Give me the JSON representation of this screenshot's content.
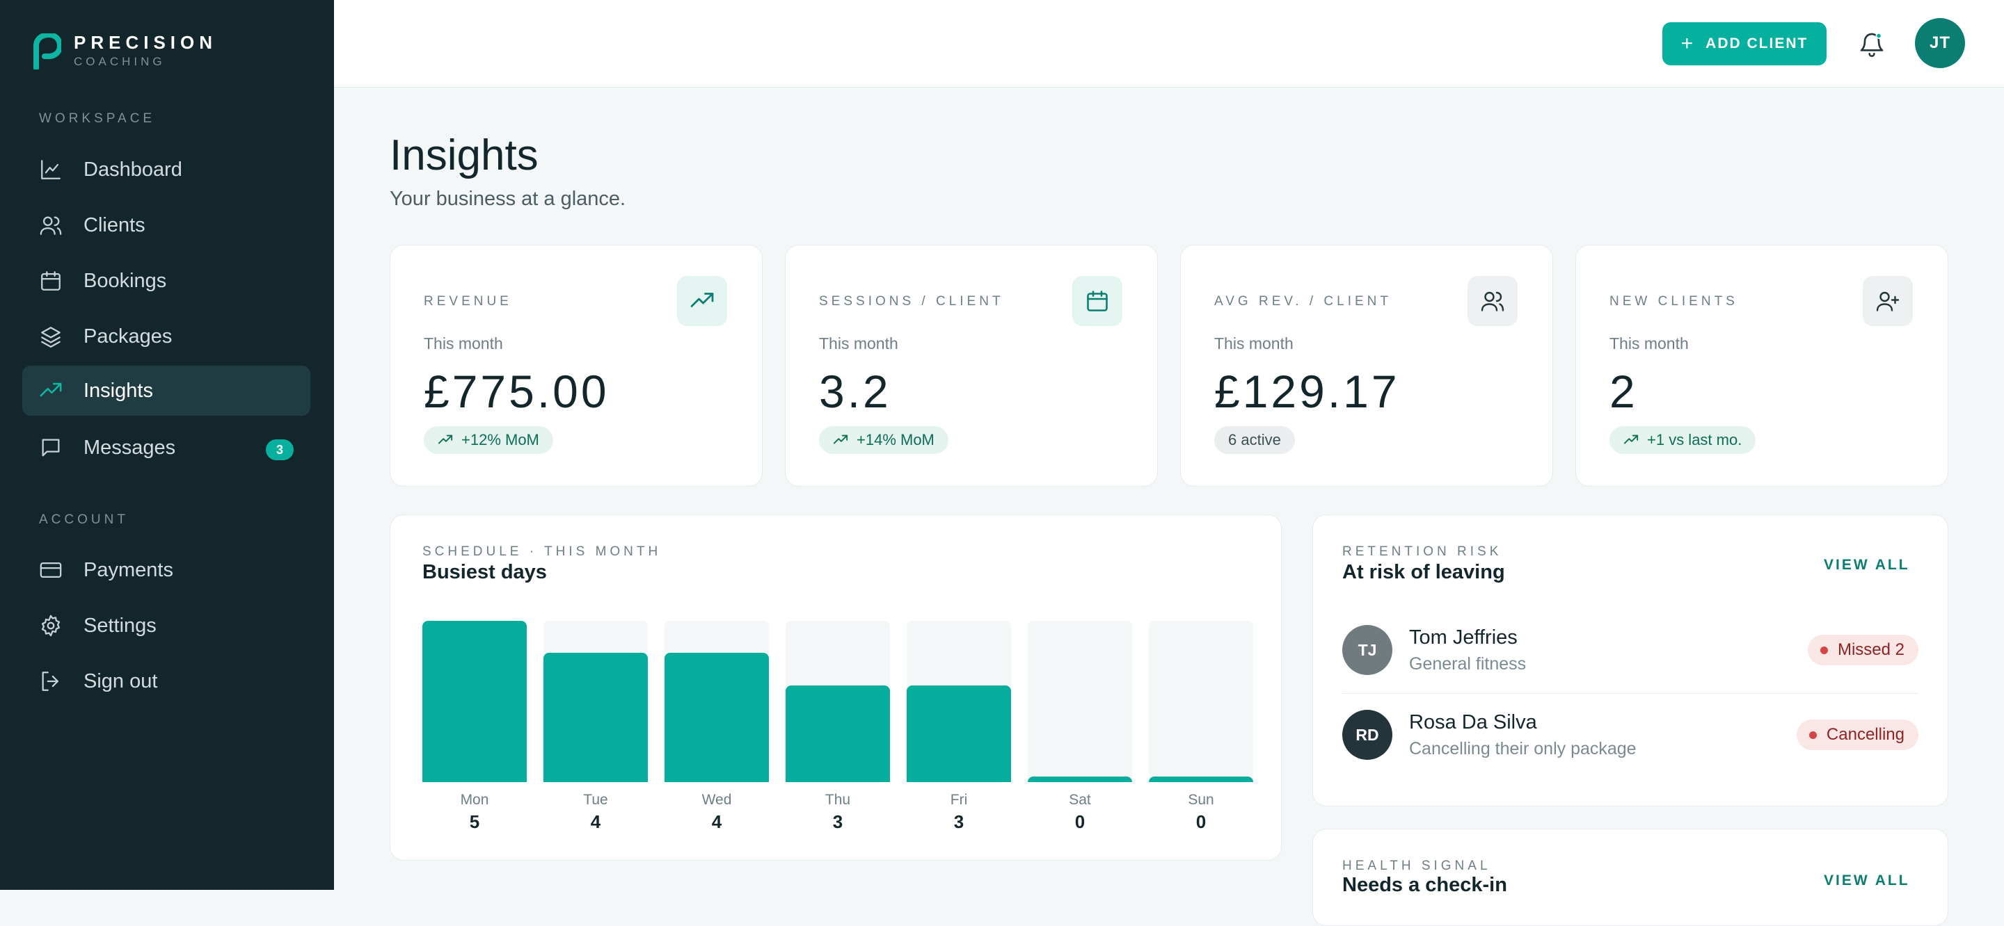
{
  "brand": {
    "name": "PRECISION",
    "sub": "COACHING",
    "logo_icon": "p-logo-icon"
  },
  "sidebar": {
    "workspace_label": "WORKSPACE",
    "account_label": "ACCOUNT",
    "workspace_items": [
      {
        "label": "Dashboard",
        "icon": "chart-line-icon"
      },
      {
        "label": "Clients",
        "icon": "users-icon"
      },
      {
        "label": "Bookings",
        "icon": "calendar-icon"
      },
      {
        "label": "Packages",
        "icon": "layers-icon"
      },
      {
        "label": "Insights",
        "icon": "trending-up-icon",
        "active": true
      },
      {
        "label": "Messages",
        "icon": "message-icon",
        "badge": "3"
      }
    ],
    "account_items": [
      {
        "label": "Payments",
        "icon": "credit-card-icon"
      },
      {
        "label": "Settings",
        "icon": "gear-icon"
      },
      {
        "label": "Sign out",
        "icon": "sign-out-icon"
      }
    ]
  },
  "topbar": {
    "add_client_label": "ADD CLIENT",
    "avatar_initials": "JT"
  },
  "page": {
    "title": "Insights",
    "subtitle": "Your business at a glance."
  },
  "stats": [
    {
      "label": "REVENUE",
      "period": "This month",
      "value": "£775.00",
      "chip": "+12% MoM",
      "chip_style": "green",
      "icon": "trending-up-icon"
    },
    {
      "label": "SESSIONS / CLIENT",
      "period": "This month",
      "value": "3.2",
      "chip": "+14% MoM",
      "chip_style": "green",
      "icon": "calendar-icon"
    },
    {
      "label": "AVG REV. / CLIENT",
      "period": "This month",
      "value": "£129.17",
      "chip": "6 active",
      "chip_style": "grey",
      "icon": "users-icon"
    },
    {
      "label": "NEW CLIENTS",
      "period": "This month",
      "value": "2",
      "chip": "+1 vs last mo.",
      "chip_style": "green",
      "icon": "user-plus-icon"
    }
  ],
  "schedule": {
    "eyebrow": "SCHEDULE · THIS MONTH",
    "title": "Busiest days"
  },
  "chart_data": {
    "type": "bar",
    "title": "Busiest days",
    "categories": [
      "Mon",
      "Tue",
      "Wed",
      "Thu",
      "Fri",
      "Sat",
      "Sun"
    ],
    "values": [
      5,
      4,
      4,
      3,
      3,
      0,
      0
    ],
    "ylim": [
      0,
      5
    ],
    "grid": false,
    "color": "#06ad9c"
  },
  "retention": {
    "eyebrow": "RETENTION RISK",
    "title": "At risk of leaving",
    "view_all": "VIEW ALL",
    "clients": [
      {
        "initials": "TJ",
        "name": "Tom Jeffries",
        "desc": "General fitness",
        "badge": "Missed 2",
        "avatar_color": "#6f7b7e"
      },
      {
        "initials": "RD",
        "name": "Rosa Da Silva",
        "desc": "Cancelling their only package",
        "badge": "Cancelling",
        "avatar_color": "#23353a"
      }
    ]
  },
  "health": {
    "eyebrow": "HEALTH SIGNAL",
    "title": "Needs a check-in",
    "view_all": "VIEW ALL"
  },
  "colors": {
    "accent": "#06b09f",
    "sidebar_bg": "#13262b",
    "sidebar_active": "#1f3c42",
    "danger": "#d64545"
  }
}
